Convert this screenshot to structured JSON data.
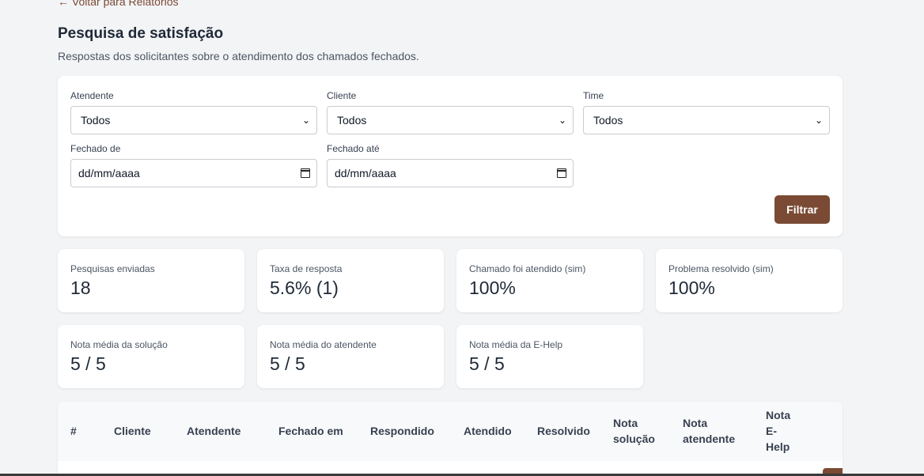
{
  "nav": {
    "back_label": "← Voltar para Relatórios"
  },
  "header": {
    "title": "Pesquisa de satisfação",
    "subtitle": "Respostas dos solicitantes sobre o atendimento dos chamados fechados."
  },
  "filters": {
    "attendant": {
      "label": "Atendente",
      "value": "Todos"
    },
    "client": {
      "label": "Cliente",
      "value": "Todos"
    },
    "team": {
      "label": "Time",
      "value": "Todos"
    },
    "closed_from": {
      "label": "Fechado de",
      "placeholder": "dd/mm/aaaa"
    },
    "closed_to": {
      "label": "Fechado até",
      "placeholder": "dd/mm/aaaa"
    },
    "submit_label": "Filtrar"
  },
  "stats": [
    {
      "label": "Pesquisas enviadas",
      "value": "18"
    },
    {
      "label": "Taxa de resposta",
      "value": "5.6% (1)"
    },
    {
      "label": "Chamado foi atendido (sim)",
      "value": "100%"
    },
    {
      "label": "Problema resolvido (sim)",
      "value": "100%"
    },
    {
      "label": "Nota média da solução",
      "value": "5 / 5"
    },
    {
      "label": "Nota média do atendente",
      "value": "5 / 5"
    },
    {
      "label": "Nota média da E-Help",
      "value": "5 / 5"
    }
  ],
  "table": {
    "columns": [
      "#",
      "Cliente",
      "Atendente",
      "Fechado em",
      "Respondido",
      "Atendido",
      "Resolvido",
      "Nota solução",
      "Nota atendente",
      "Nota E-Help"
    ]
  },
  "colors": {
    "accent": "#7a4a34",
    "background": "#f3f4f6"
  }
}
